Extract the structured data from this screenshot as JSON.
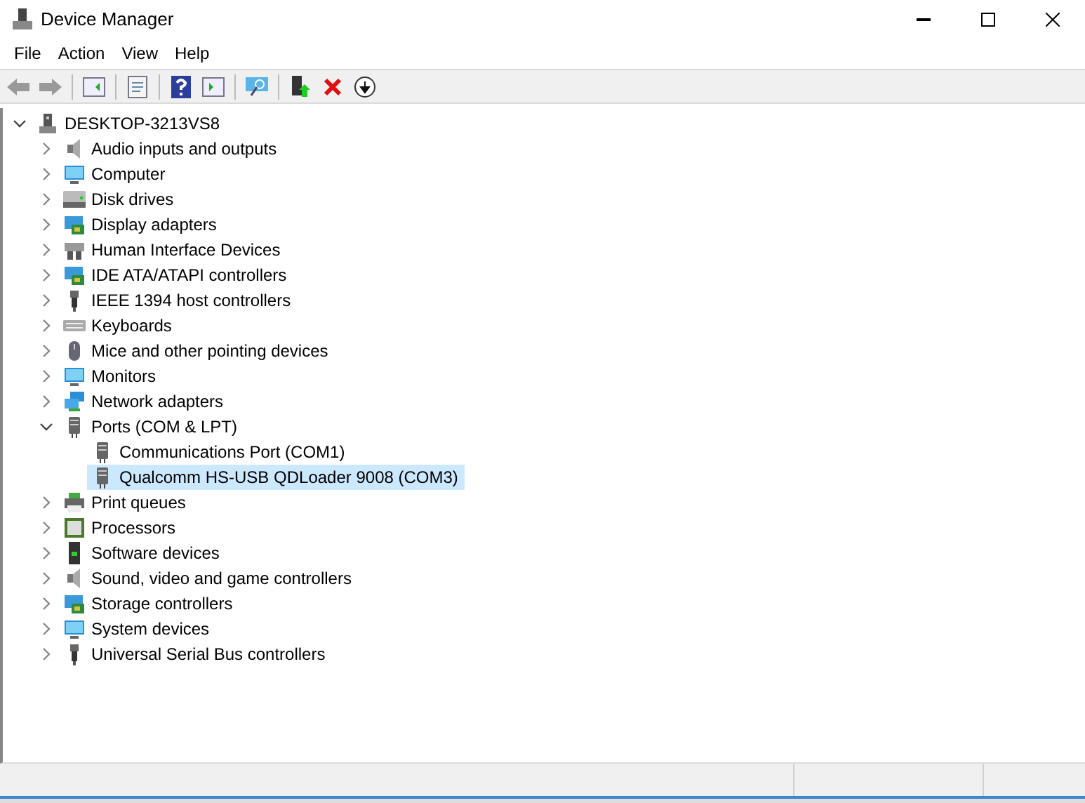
{
  "window": {
    "title": "Device Manager"
  },
  "menu": [
    "File",
    "Action",
    "View",
    "Help"
  ],
  "tree": [
    {
      "label": "DESKTOP-3213VS8",
      "kind": "pc",
      "expanded": true,
      "selected": false,
      "children": [
        {
          "label": "Audio inputs and outputs",
          "kind": "speaker",
          "expanded": false,
          "selected": false
        },
        {
          "label": "Computer",
          "kind": "monitor",
          "expanded": false,
          "selected": false
        },
        {
          "label": "Disk drives",
          "kind": "disk",
          "expanded": false,
          "selected": false
        },
        {
          "label": "Display adapters",
          "kind": "card",
          "expanded": false,
          "selected": false
        },
        {
          "label": "Human Interface Devices",
          "kind": "hid",
          "expanded": false,
          "selected": false
        },
        {
          "label": "IDE ATA/ATAPI controllers",
          "kind": "card",
          "expanded": false,
          "selected": false
        },
        {
          "label": "IEEE 1394 host controllers",
          "kind": "plug",
          "expanded": false,
          "selected": false
        },
        {
          "label": "Keyboards",
          "kind": "keyboard",
          "expanded": false,
          "selected": false
        },
        {
          "label": "Mice and other pointing devices",
          "kind": "mouse",
          "expanded": false,
          "selected": false
        },
        {
          "label": "Monitors",
          "kind": "monitor",
          "expanded": false,
          "selected": false
        },
        {
          "label": "Network adapters",
          "kind": "network",
          "expanded": false,
          "selected": false
        },
        {
          "label": "Ports (COM & LPT)",
          "kind": "port",
          "expanded": true,
          "selected": false,
          "children": [
            {
              "label": "Communications Port (COM1)",
              "kind": "port",
              "selected": false
            },
            {
              "label": "Qualcomm HS-USB QDLoader 9008 (COM3)",
              "kind": "port",
              "selected": true
            }
          ]
        },
        {
          "label": "Print queues",
          "kind": "printer",
          "expanded": false,
          "selected": false
        },
        {
          "label": "Processors",
          "kind": "chip",
          "expanded": false,
          "selected": false
        },
        {
          "label": "Software devices",
          "kind": "tower",
          "expanded": false,
          "selected": false
        },
        {
          "label": "Sound, video and game controllers",
          "kind": "speaker",
          "expanded": false,
          "selected": false
        },
        {
          "label": "Storage controllers",
          "kind": "card",
          "expanded": false,
          "selected": false
        },
        {
          "label": "System devices",
          "kind": "monitor",
          "expanded": false,
          "selected": false
        },
        {
          "label": "Universal Serial Bus controllers",
          "kind": "plug",
          "expanded": false,
          "selected": false
        }
      ]
    }
  ]
}
